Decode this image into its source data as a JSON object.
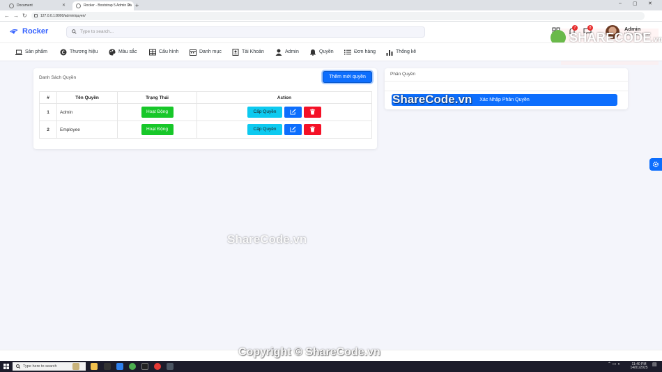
{
  "browser": {
    "tabs": [
      {
        "title": "Document"
      },
      {
        "title": "Rocker - Bootstrap 5 Admin Da"
      }
    ],
    "new_tab": "+",
    "url": "127.0.0.1:8000/admin/quyen/"
  },
  "app": {
    "logo": "Rocker",
    "search_placeholder": "Type to search...",
    "notifications_count": "7",
    "messages_count": "8",
    "user_name": "Admin",
    "user_role": "Web Designer"
  },
  "menu": [
    {
      "label": "Sản phẩm",
      "icon": "laptop-icon"
    },
    {
      "label": "Thương hiệu",
      "icon": "copyright-icon"
    },
    {
      "label": "Màu sắc",
      "icon": "palette-icon"
    },
    {
      "label": "Cấu hình",
      "icon": "table-icon"
    },
    {
      "label": "Danh mục",
      "icon": "calendar-icon"
    },
    {
      "label": "Tài Khoản",
      "icon": "contact-card-icon"
    },
    {
      "label": "Admin",
      "icon": "user-icon"
    },
    {
      "label": "Quyền",
      "icon": "bell-icon"
    },
    {
      "label": "Đơn hàng",
      "icon": "list-icon"
    },
    {
      "label": "Thống kê",
      "icon": "bar-chart-icon"
    }
  ],
  "left_card": {
    "title": "Danh Sách Quyền",
    "add_button": "Thêm mới quyền",
    "columns": [
      "#",
      "Tên Quyền",
      "Trạng Thái",
      "Action"
    ],
    "rows": [
      {
        "index": "1",
        "name": "Admin",
        "status": "Hoạt Động",
        "grant": "Cấp Quyền"
      },
      {
        "index": "2",
        "name": "Employee",
        "status": "Hoạt Động",
        "grant": "Cấp Quyền"
      }
    ]
  },
  "right_card": {
    "title": "Phân Quyền",
    "submit_button": "Xác Nhập Phân Quyền"
  },
  "watermarks": {
    "brand": "SHARECODE",
    "brand_domain": ".vn",
    "mid_right": "ShareCode.vn",
    "center": "ShareCode.vn",
    "bottom": "Copyright © ShareCode.vn"
  },
  "taskbar": {
    "search_placeholder": "Type here to search",
    "time": "11:40 PM",
    "date": "14/01/2025"
  },
  "colors": {
    "primary": "#0d6efd",
    "success": "#17c729",
    "info": "#0dcaf0",
    "danger": "#f41127",
    "logo": "#3461ff"
  }
}
